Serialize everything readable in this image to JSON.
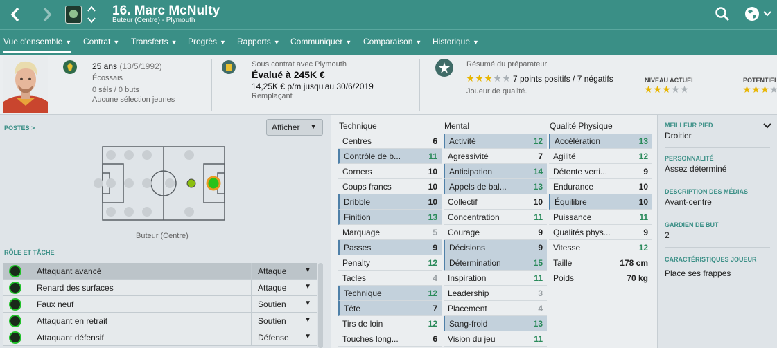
{
  "header": {
    "title": "16. Marc McNulty",
    "subtitle": "Buteur (Centre) - Plymouth"
  },
  "tabs": [
    {
      "label": "Vue d'ensemble",
      "active": true
    },
    {
      "label": "Contrat"
    },
    {
      "label": "Transferts"
    },
    {
      "label": "Progrès"
    },
    {
      "label": "Rapports"
    },
    {
      "label": "Communiquer"
    },
    {
      "label": "Comparaison"
    },
    {
      "label": "Historique"
    }
  ],
  "summary": {
    "age": "25 ans",
    "dob": "(13/5/1992)",
    "nationality": "Écossais",
    "caps": "0 séls / 0 buts",
    "youth": "Aucune sélection jeunes",
    "contract_title": "Sous contrat avec Plymouth",
    "value": "Évalué à 245K €",
    "wage": "14,25K € p/m jusqu'au 30/6/2019",
    "squad_status": "Remplaçant",
    "coach_title": "Résumé du préparateur",
    "coach_points": "7 points positifs / 7 négatifs",
    "coach_note": "Joueur de qualité.",
    "current_level_label": "NIVEAU ACTUEL",
    "potential_label": "POTENTIEL",
    "coach_stars": 3,
    "current_stars": 3,
    "potential_stars": 3
  },
  "positions": {
    "caption": "POSTES >",
    "show_button": "Afficher",
    "position_label": "Buteur (Centre)"
  },
  "roles": {
    "caption": "RÔLE ET TÂCHE",
    "items": [
      {
        "name": "Attaquant avancé",
        "duty": "Attaque",
        "selected": true
      },
      {
        "name": "Renard des surfaces",
        "duty": "Attaque"
      },
      {
        "name": "Faux neuf",
        "duty": "Soutien"
      },
      {
        "name": "Attaquant en retrait",
        "duty": "Soutien"
      },
      {
        "name": "Attaquant défensif",
        "duty": "Défense"
      }
    ]
  },
  "attributes": {
    "technique": {
      "title": "Technique",
      "items": [
        {
          "name": "Centres",
          "value": "6",
          "color": "black"
        },
        {
          "name": "Contrôle de b...",
          "value": "11",
          "color": "green",
          "hl": true
        },
        {
          "name": "Corners",
          "value": "10",
          "color": "black"
        },
        {
          "name": "Coups francs",
          "value": "10",
          "color": "black"
        },
        {
          "name": "Dribble",
          "value": "10",
          "color": "black",
          "hl": true
        },
        {
          "name": "Finition",
          "value": "13",
          "color": "green",
          "hl": true
        },
        {
          "name": "Marquage",
          "value": "5",
          "color": "grey"
        },
        {
          "name": "Passes",
          "value": "9",
          "color": "black",
          "hl": true
        },
        {
          "name": "Penalty",
          "value": "12",
          "color": "green"
        },
        {
          "name": "Tacles",
          "value": "4",
          "color": "grey"
        },
        {
          "name": "Technique",
          "value": "12",
          "color": "green",
          "hl": true
        },
        {
          "name": "Tête",
          "value": "7",
          "color": "black",
          "hl": true
        },
        {
          "name": "Tirs de loin",
          "value": "12",
          "color": "green"
        },
        {
          "name": "Touches long...",
          "value": "6",
          "color": "black"
        }
      ]
    },
    "mental": {
      "title": "Mental",
      "items": [
        {
          "name": "Activité",
          "value": "12",
          "color": "green",
          "hl": true
        },
        {
          "name": "Agressivité",
          "value": "7",
          "color": "black"
        },
        {
          "name": "Anticipation",
          "value": "14",
          "color": "green",
          "hl": true
        },
        {
          "name": "Appels de bal...",
          "value": "13",
          "color": "green",
          "hl": true
        },
        {
          "name": "Collectif",
          "value": "10",
          "color": "black"
        },
        {
          "name": "Concentration",
          "value": "11",
          "color": "green"
        },
        {
          "name": "Courage",
          "value": "9",
          "color": "black"
        },
        {
          "name": "Décisions",
          "value": "9",
          "color": "black",
          "hl": true
        },
        {
          "name": "Détermination",
          "value": "15",
          "color": "green",
          "hl": true
        },
        {
          "name": "Inspiration",
          "value": "11",
          "color": "green"
        },
        {
          "name": "Leadership",
          "value": "3",
          "color": "grey"
        },
        {
          "name": "Placement",
          "value": "4",
          "color": "grey"
        },
        {
          "name": "Sang-froid",
          "value": "13",
          "color": "green",
          "hl": true
        },
        {
          "name": "Vision du jeu",
          "value": "11",
          "color": "green"
        }
      ]
    },
    "physical": {
      "title": "Qualité Physique",
      "items": [
        {
          "name": "Accélération",
          "value": "13",
          "color": "green",
          "hl": true
        },
        {
          "name": "Agilité",
          "value": "12",
          "color": "green"
        },
        {
          "name": "Détente verti...",
          "value": "9",
          "color": "black"
        },
        {
          "name": "Endurance",
          "value": "10",
          "color": "black"
        },
        {
          "name": "Équilibre",
          "value": "10",
          "color": "black",
          "hl": true
        },
        {
          "name": "Puissance",
          "value": "11",
          "color": "green"
        },
        {
          "name": "Qualités phys...",
          "value": "9",
          "color": "black"
        },
        {
          "name": "Vitesse",
          "value": "12",
          "color": "green"
        }
      ],
      "height_label": "Taille",
      "height": "178 cm",
      "weight_label": "Poids",
      "weight": "70 kg"
    }
  },
  "info": {
    "best_foot_label": "MEILLEUR PIED",
    "best_foot": "Droitier",
    "personality_label": "PERSONNALITÉ",
    "personality": "Assez déterminé",
    "media_label": "DESCRIPTION DES MÉDIAS",
    "media": "Avant-centre",
    "gk_label": "GARDIEN DE BUT",
    "gk": "2",
    "traits_label": "CARACTÉRISTIQUES JOUEUR",
    "traits": "Place ses frappes"
  },
  "colors": {
    "brand": "#3a8f86",
    "attr_green": "#2a8a5a",
    "highlight": "#c3d1dc",
    "star": "#e8b500"
  }
}
